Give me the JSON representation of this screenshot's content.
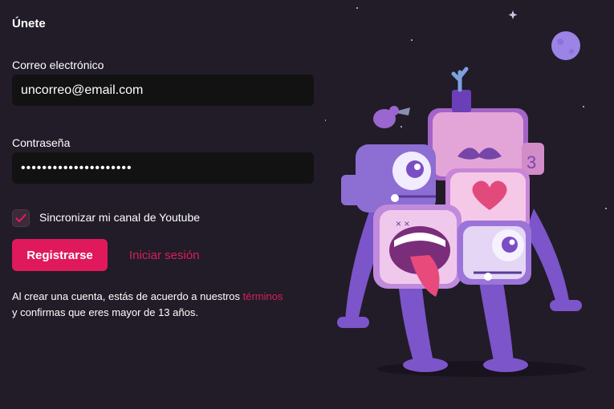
{
  "form": {
    "title": "Únete",
    "email_label": "Correo electrónico",
    "email_value": "uncorreo@email.com",
    "password_label": "Contraseña",
    "password_value": "•••••••••••••••••••••",
    "sync_label": "Sincronizar mi canal de Youtube",
    "sync_checked": true,
    "register_label": "Registrarse",
    "login_label": "Iniciar sesión",
    "terms_prefix": "Al crear una cuenta, estás de acuerdo a nuestros ",
    "terms_link": "términos",
    "terms_suffix": "y confirmas que eres mayor de 13 años."
  },
  "colors": {
    "background": "#211c28",
    "input_bg": "#121212",
    "accent": "#e0195c",
    "link": "#d81f5b"
  },
  "icons": [
    "check-icon",
    "monster-illustration",
    "moon-icon",
    "star-icon"
  ]
}
